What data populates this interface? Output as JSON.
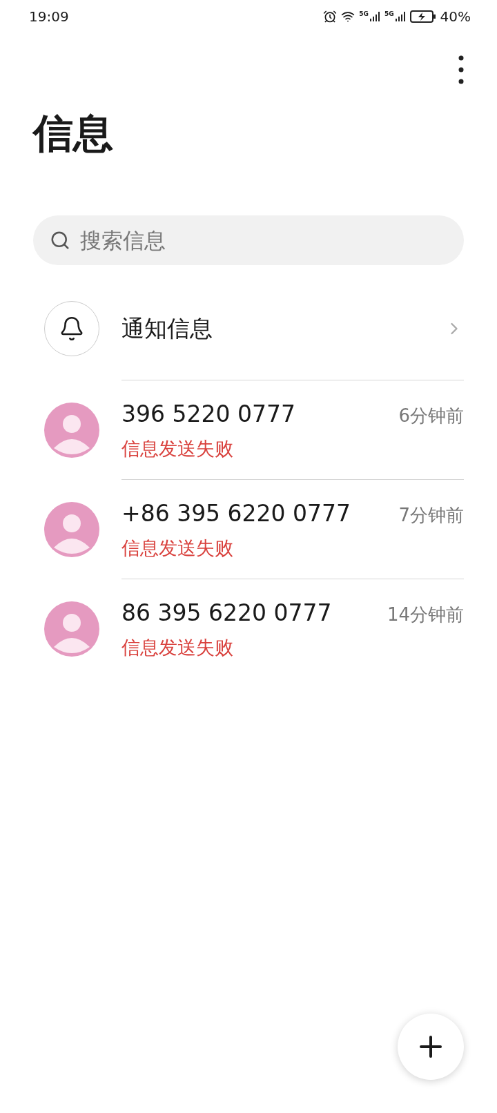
{
  "status_bar": {
    "time": "19:09",
    "network_1": "5G",
    "network_2": "5G",
    "battery": "40%"
  },
  "title": "信息",
  "search": {
    "placeholder": "搜索信息"
  },
  "notifications": {
    "label": "通知信息"
  },
  "conversations": [
    {
      "name": "396 5220 0777",
      "time": "6分钟前",
      "preview": "信息发送失败"
    },
    {
      "name": "+86 395 6220 0777",
      "time": "7分钟前",
      "preview": "信息发送失败"
    },
    {
      "name": "86 395 6220 0777",
      "time": "14分钟前",
      "preview": "信息发送失败"
    }
  ]
}
